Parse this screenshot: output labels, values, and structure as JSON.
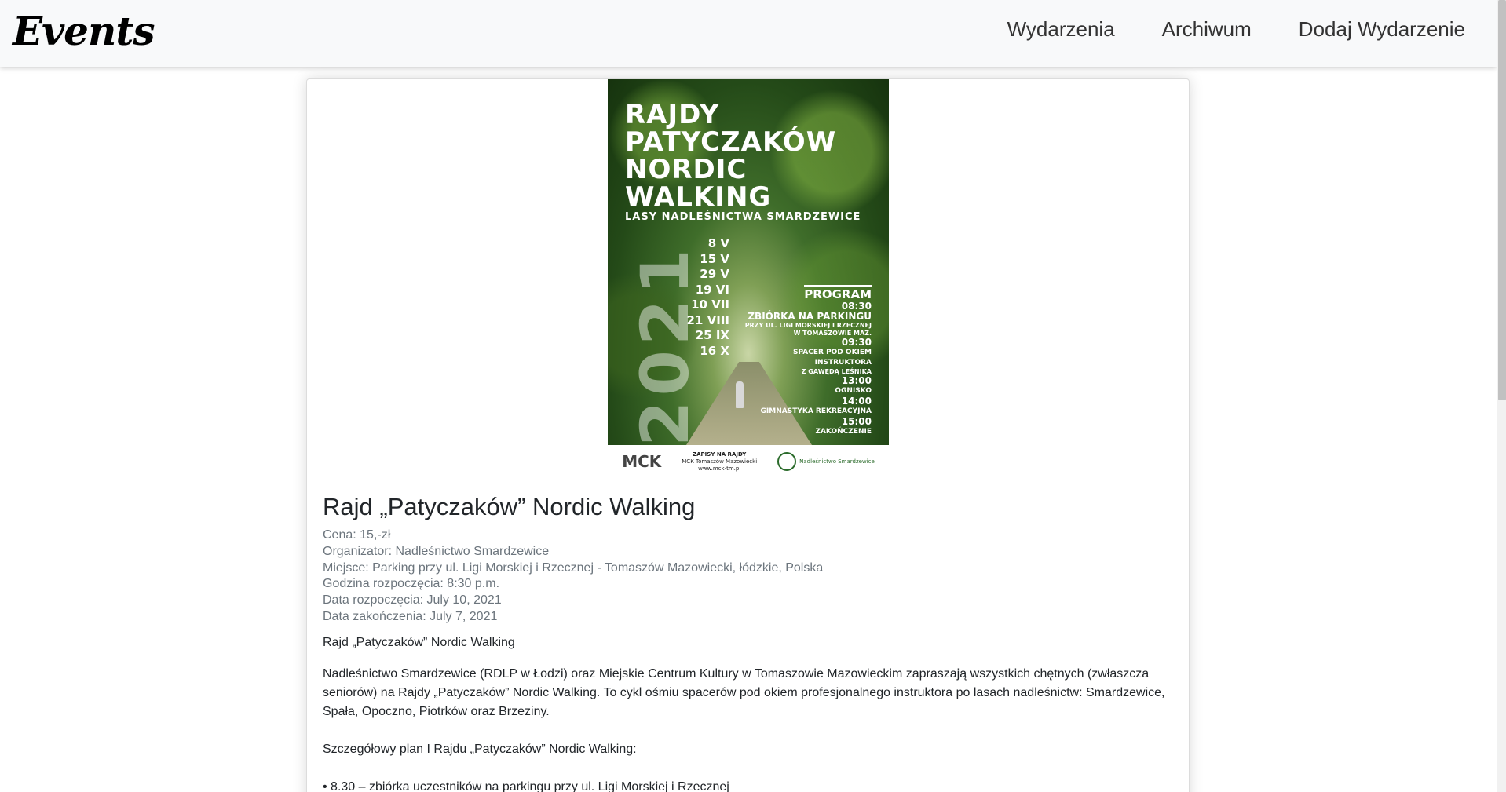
{
  "navbar": {
    "brand": "Events",
    "links": [
      "Wydarzenia",
      "Archiwum",
      "Dodaj Wydarzenie"
    ]
  },
  "poster": {
    "title_lines": [
      "RAJDY",
      "PATYCZAKÓW",
      "NORDIC",
      "WALKING"
    ],
    "subtitle": "LASY NADLEŚNICTWA SMARDZEWICE",
    "year": "2021",
    "dates": [
      "8 V",
      "15 V",
      "29 V",
      "19 VI",
      "10 VII",
      "21 VIII",
      "25 IX",
      "16 X"
    ],
    "program_label": "PROGRAM",
    "program": [
      {
        "time": "08:30",
        "text": "ZBIÓRKA NA PARKINGU",
        "small": "PRZY UL. LIGI MORSKIEJ I RZECZNEJ W TOMASZOWIE MAZ."
      },
      {
        "time": "09:30",
        "text": "SPACER POD OKIEM INSTRUKTORA",
        "small": "Z GAWĘDĄ LEŚNIKA"
      },
      {
        "time": "13:00",
        "text": "OGNISKO",
        "small": ""
      },
      {
        "time": "14:00",
        "text": "GIMNASTYKA REKREACYJNA",
        "small": ""
      },
      {
        "time": "15:00",
        "text": "ZAKOŃCZENIE",
        "small": ""
      }
    ],
    "footer": {
      "logo_left": "MCK",
      "mid_lines": [
        "ZAPISY NA RAJDY",
        "MCK Tomaszów Mazowiecki",
        "www.mck-tm.pl"
      ],
      "logo_right": "Nadleśnictwo Smardzewice"
    }
  },
  "event": {
    "title": "Rajd „Patyczaków” Nordic Walking",
    "price": "Cena: 15,-zł",
    "organizer": "Organizator: Nadleśnictwo Smardzewice",
    "place": "Miejsce: Parking przy ul. Ligi Morskiej i Rzecznej - Tomaszów Mazowiecki, łódzkie, Polska",
    "start_time": "Godzina rozpoczęcia: 8:30 p.m.",
    "start_date": "Data rozpoczęcia: July 10, 2021",
    "end_date": "Data zakończenia: July 7, 2021",
    "desc_title": "Rajd „Patyczaków” Nordic Walking",
    "desc_body": "Nadleśnictwo Smardzewice (RDLP w Łodzi) oraz Miejskie Centrum Kultury w Tomaszowie Mazowieckim zapraszają wszystkich chętnych (zwłaszcza seniorów) na Rajdy „Patyczaków” Nordic Walking. To cykl ośmiu spacerów pod okiem profesjonalnego instruktora po lasach nadleśnictw: Smardzewice, Spała, Opoczno, Piotrków oraz Brzeziny.",
    "plan_heading": "Szczegółowy plan I Rajdu „Patyczaków” Nordic Walking:",
    "plan_first": "• 8.30 – zbiórka uczestników na parkingu przy ul. Ligi Morskiej i Rzecznej"
  }
}
